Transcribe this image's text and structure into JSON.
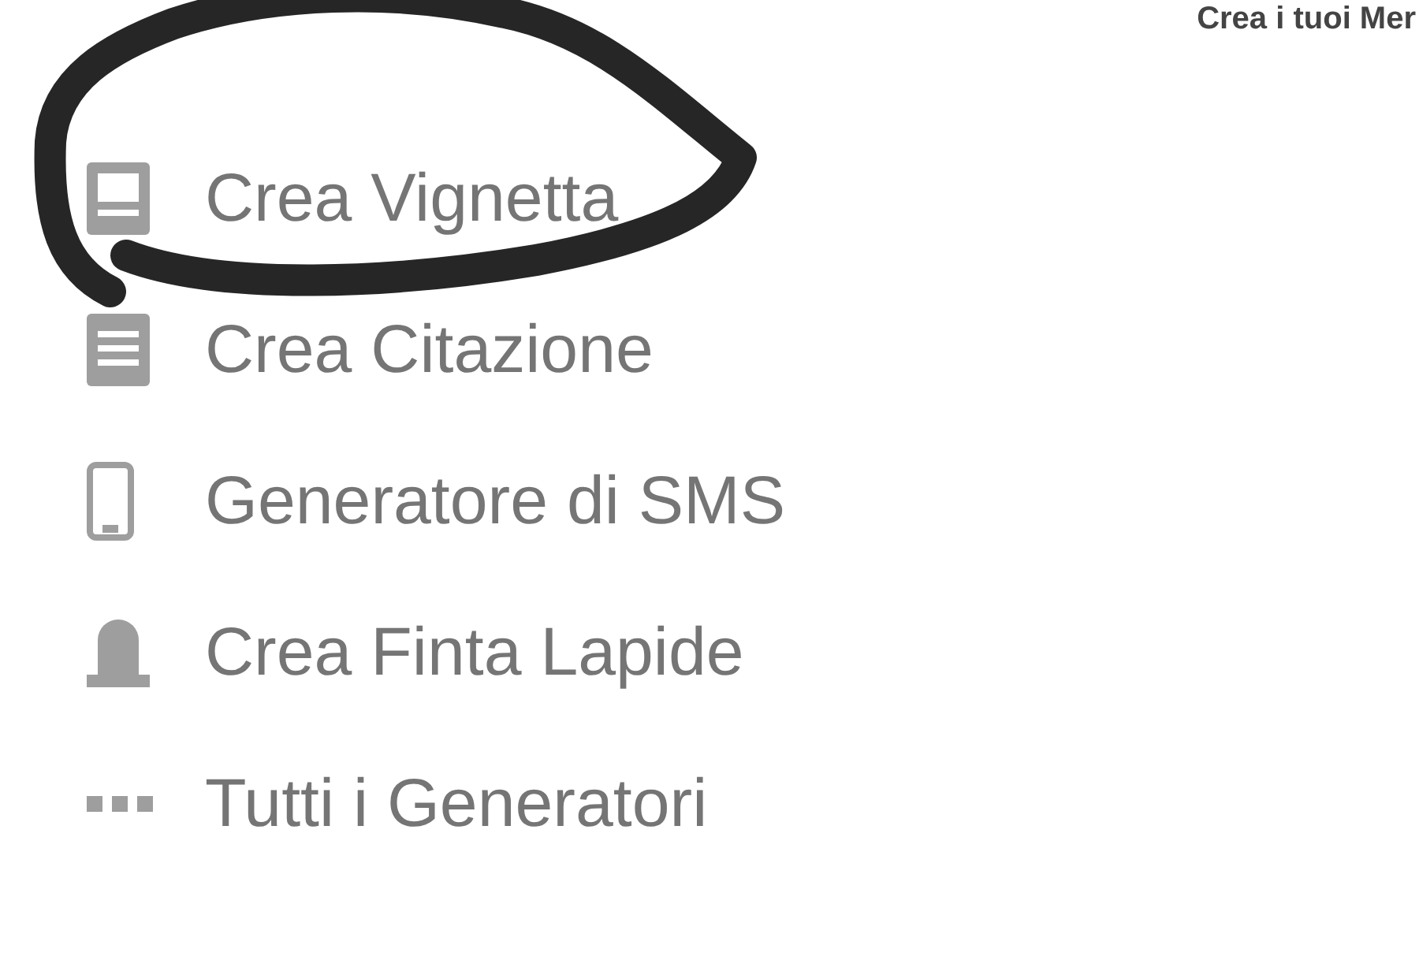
{
  "header": {
    "title": "Crea i tuoi Mer"
  },
  "menu": {
    "items": [
      {
        "label": "Crea Vignetta",
        "kind": "comic"
      },
      {
        "label": "Crea Citazione",
        "kind": "quote"
      },
      {
        "label": "Generatore di SMS",
        "kind": "phone"
      },
      {
        "label": "Crea Finta Lapide",
        "kind": "tombstone"
      },
      {
        "label": "Tutti i Generatori",
        "kind": "more"
      }
    ]
  }
}
